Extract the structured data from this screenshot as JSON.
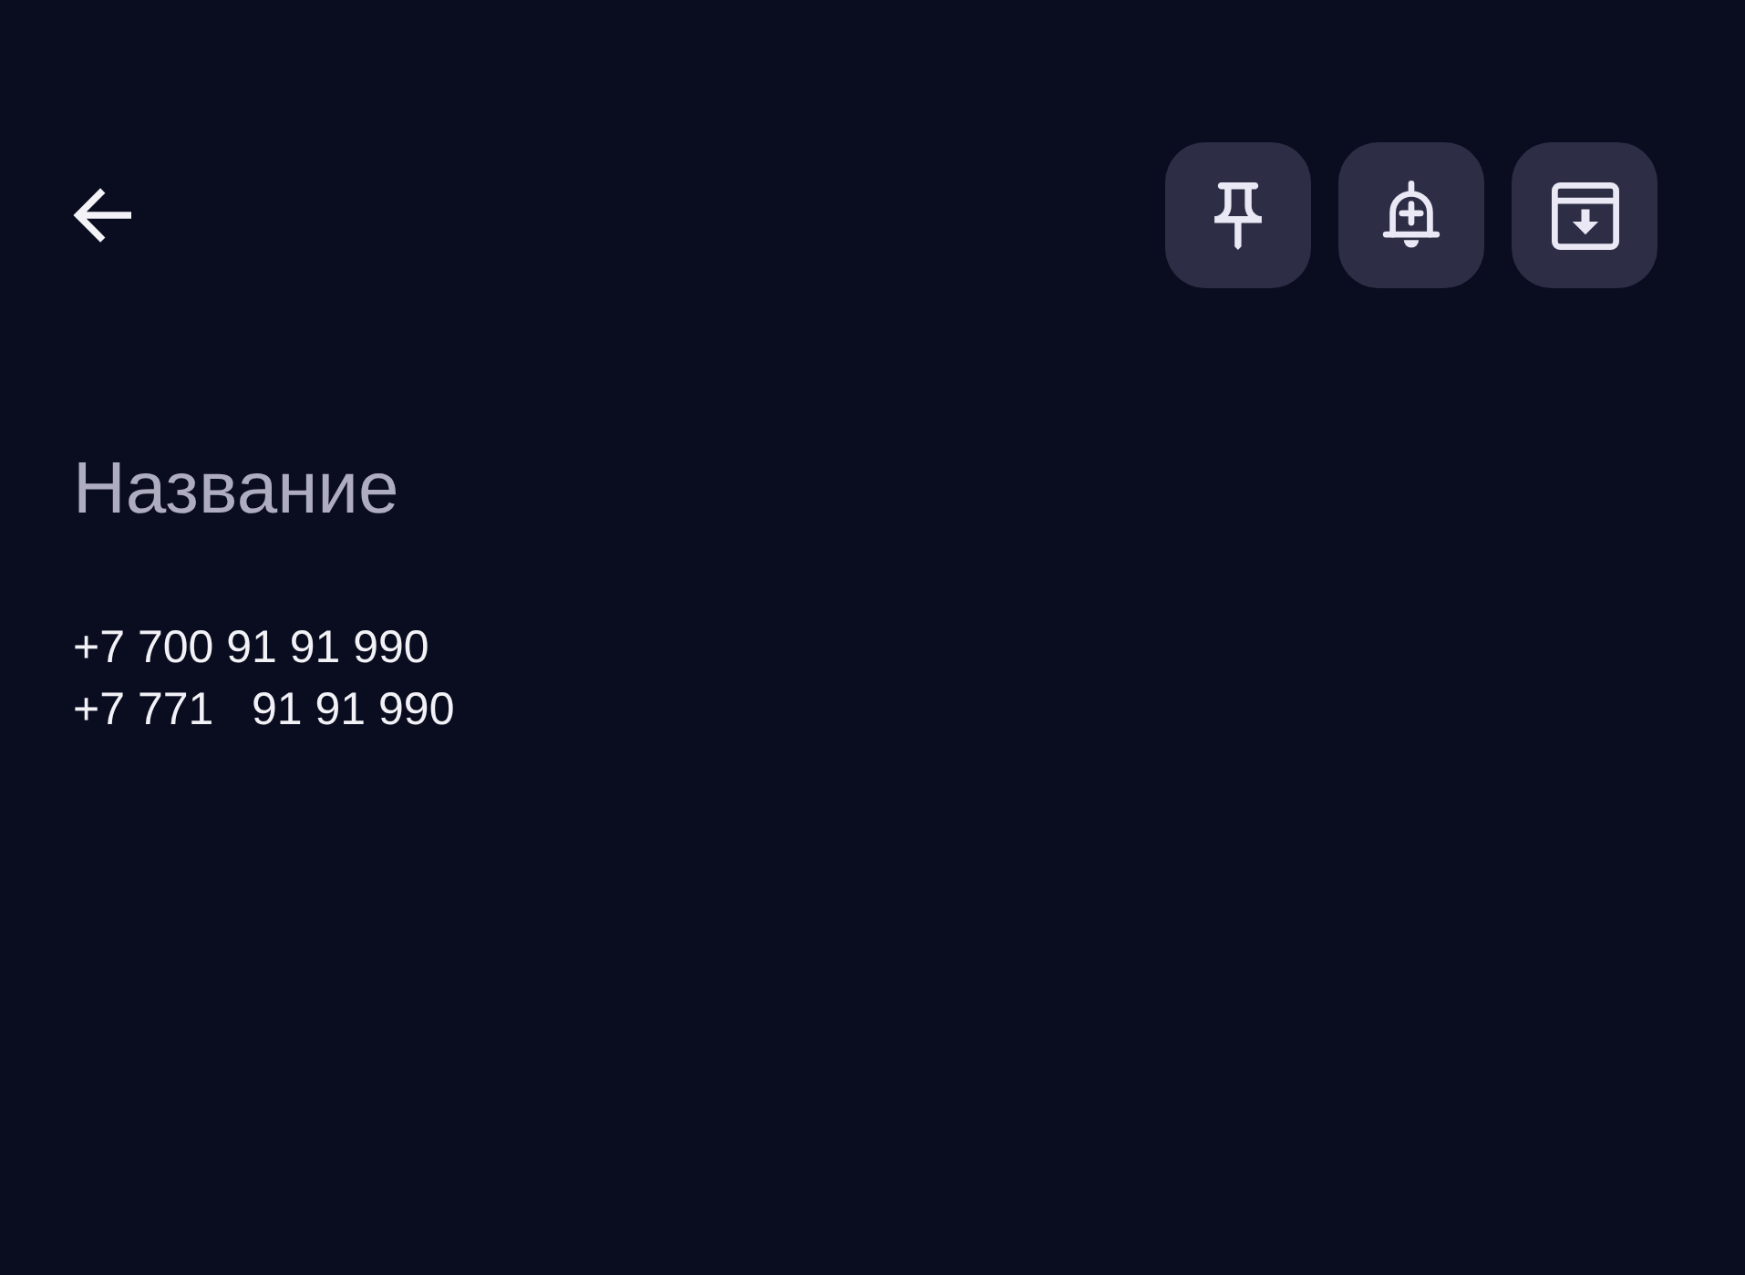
{
  "toolbar": {
    "back_button": {
      "kind": "back"
    },
    "actions": [
      {
        "kind": "pin"
      },
      {
        "kind": "reminder"
      },
      {
        "kind": "archive"
      }
    ]
  },
  "note": {
    "title": {
      "placeholder": "Название"
    },
    "body": {
      "value": "+7 700 91 91 990\n+7 771   91 91 990"
    }
  }
}
